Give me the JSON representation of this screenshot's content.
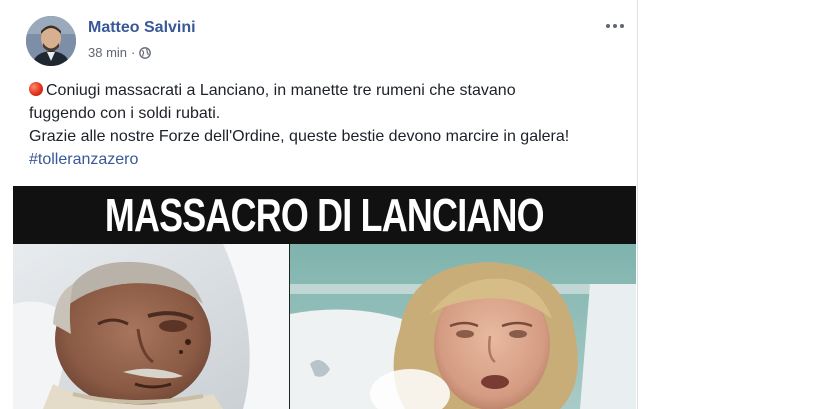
{
  "post": {
    "author": "Matteo Salvini",
    "timestamp": "38 min",
    "separator": "·",
    "privacy_icon": "globe-icon",
    "more_icon": "more-options-icon",
    "text_lines": [
      "Coniugi massacrati a Lanciano, in manette tre rumeni che stavano",
      "fuggendo con i soldi rubati.",
      "Grazie alle nostre Forze dell'Ordine, queste bestie devono marcire in galera!"
    ],
    "emoji": "red-circle-emoji",
    "hashtag": "#tolleranzazero"
  },
  "image": {
    "banner_text": "MASSACRO DI LANCIANO"
  },
  "colors": {
    "link_blue": "#385898",
    "text": "#1d2129",
    "meta_gray": "#616770",
    "banner_bg": "#111111"
  }
}
